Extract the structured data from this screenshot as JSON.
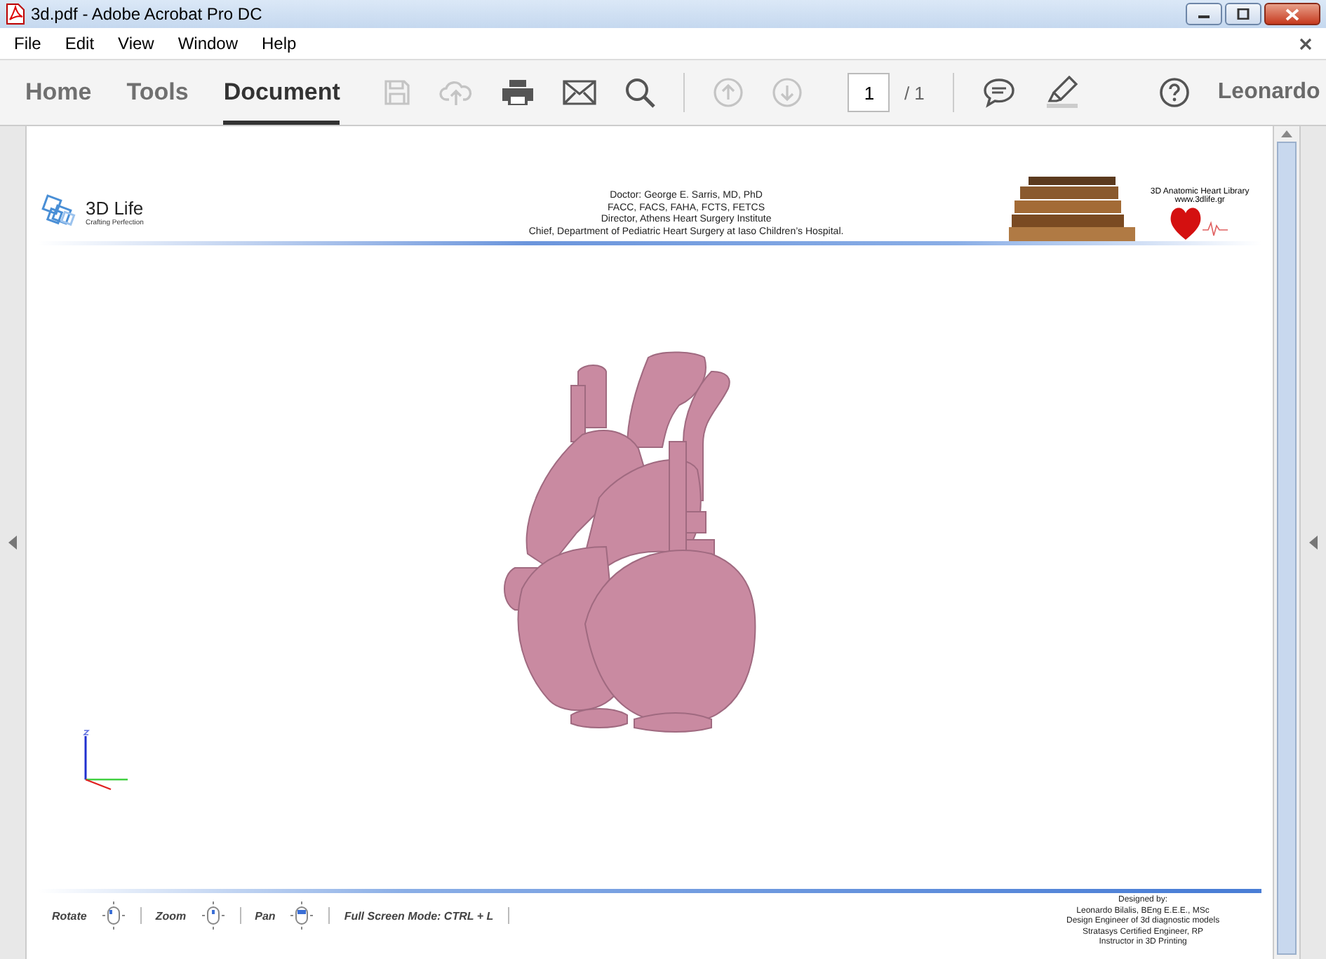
{
  "window": {
    "title": "3d.pdf - Adobe Acrobat Pro DC"
  },
  "menu": [
    "File",
    "Edit",
    "View",
    "Window",
    "Help"
  ],
  "tabs": [
    {
      "label": "Home",
      "selected": false
    },
    {
      "label": "Tools",
      "selected": false
    },
    {
      "label": "Document",
      "selected": true
    }
  ],
  "toolbar": [
    {
      "kind": "save",
      "disabled": true
    },
    {
      "kind": "upload",
      "disabled": true
    },
    {
      "kind": "print",
      "disabled": false
    },
    {
      "kind": "mail",
      "disabled": false
    },
    {
      "kind": "search",
      "disabled": false
    },
    {
      "kind": "prev",
      "disabled": true
    },
    {
      "kind": "next",
      "disabled": true
    }
  ],
  "page_number": {
    "value": "1",
    "total": "/ 1"
  },
  "user": {
    "name": "Leonardo"
  },
  "document": {
    "logo": {
      "title": "3D Life",
      "tagline": "Crafting Perfection"
    },
    "header_lines": [
      "Doctor: George E. Sarris, MD, PhD",
      "FACC, FACS, FAHA, FCTS, FETCS",
      "Director, Athens Heart Surgery Institute",
      "Chief, Department of Pediatric Heart Surgery at Iaso Children’s Hospital."
    ],
    "library": [
      "3D Anatomic Heart Library",
      "www.3dlife.gr"
    ],
    "controls": [
      {
        "label": "Rotate",
        "kind": "rotate"
      },
      {
        "label": "Zoom",
        "kind": "zoom"
      },
      {
        "label": "Pan",
        "kind": "pan"
      },
      {
        "label": "Full Screen Mode:  CTRL + L",
        "kind": "text"
      }
    ],
    "credits": [
      "Designed by:",
      "Leonardo Bilalis, BEng E.E.E., MSc",
      "Design Engineer of 3d diagnostic models",
      "Stratasys Certified Engineer, RP",
      "Instructor in 3D Printing"
    ]
  }
}
